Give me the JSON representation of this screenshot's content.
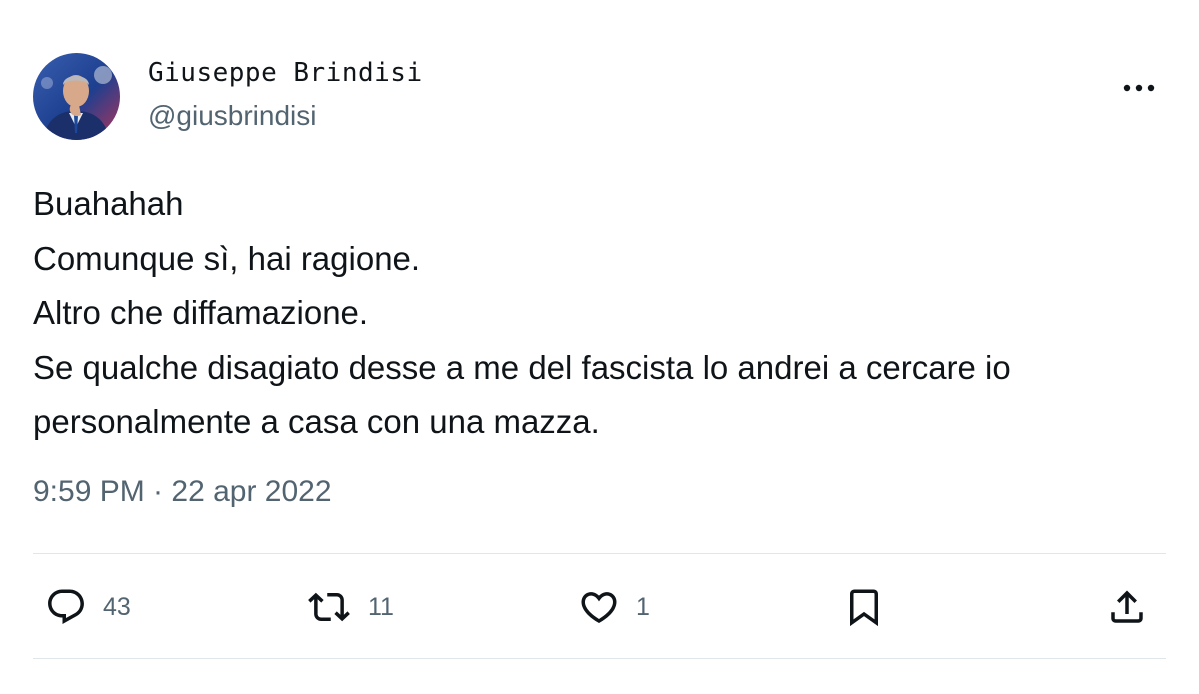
{
  "author": {
    "display_name": "Giuseppe Brindisi",
    "handle": "@giusbrindisi"
  },
  "tweet": {
    "lines": [
      "Buahahah",
      "Comunque sì, hai ragione.",
      "Altro che diffamazione.",
      "Se qualche disagiato desse a me del fascista lo andrei a cercare io",
      "personalmente a casa con una mazza."
    ],
    "timestamp": "9:59 PM · 22 apr 2022"
  },
  "actions": {
    "reply": {
      "icon": "reply-icon",
      "count": "43"
    },
    "retweet": {
      "icon": "retweet-icon",
      "count": "11"
    },
    "like": {
      "icon": "heart-icon",
      "count": "1"
    },
    "bookmark": {
      "icon": "bookmark-icon"
    },
    "share": {
      "icon": "share-icon"
    }
  },
  "colors": {
    "text": "#0f1419",
    "secondary": "#536471",
    "divider": "#e1e6ea"
  }
}
